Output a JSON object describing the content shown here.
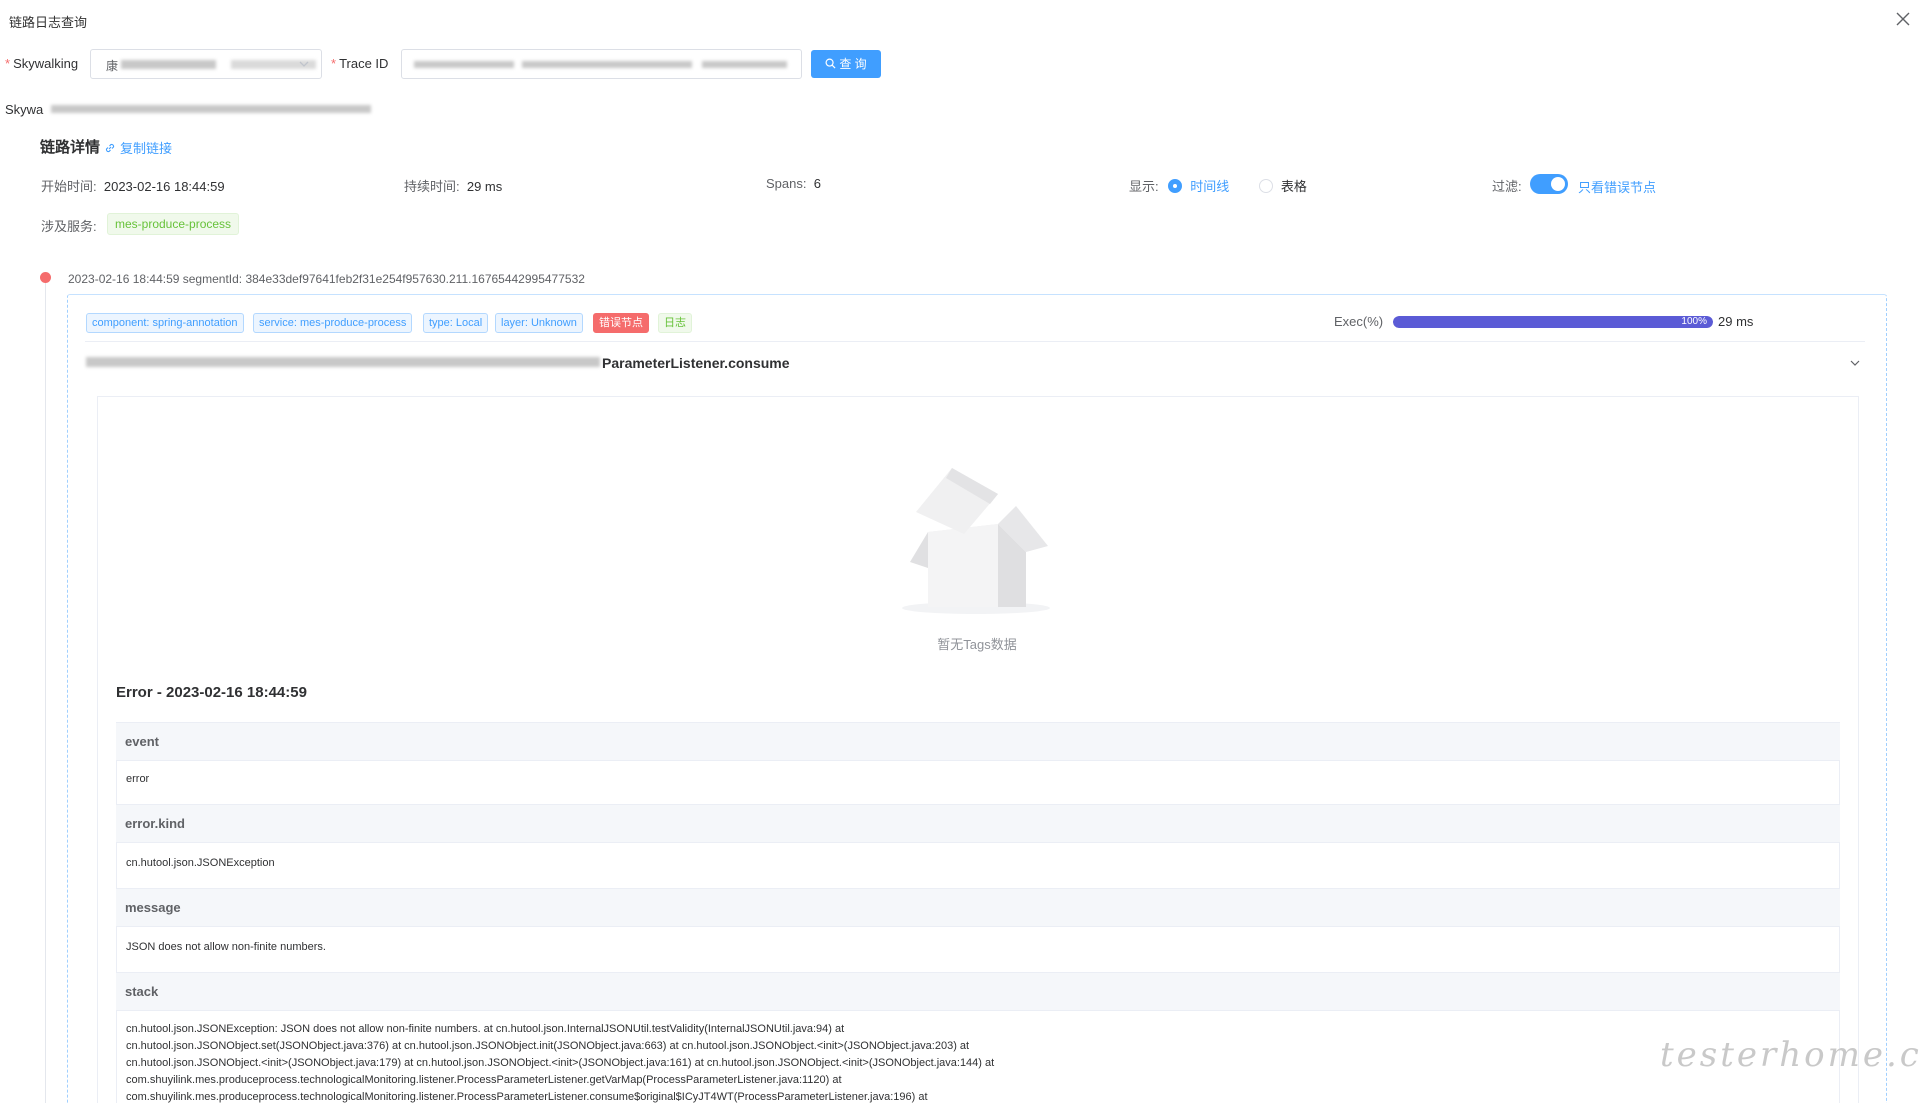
{
  "window": {
    "title": "链路日志查询"
  },
  "search": {
    "skywalking_label": "Skywalking",
    "skywalking_value_prefix": "康",
    "traceid_label": "Trace ID",
    "query_button": "查 询"
  },
  "skywa_label": "Skywa",
  "details": {
    "heading": "链路详情",
    "copy_link": "复制链接",
    "start_time_label": "开始时间:",
    "start_time": "2023-02-16 18:44:59",
    "duration_label": "持续时间:",
    "duration": "29 ms",
    "spans_label": "Spans:",
    "spans": "6",
    "display_label": "显示:",
    "display_timeline": "时间线",
    "display_table": "表格",
    "filter_label": "过滤:",
    "filter_errors_only": "只看错误节点",
    "services_label": "涉及服务:",
    "service_tag": "mes-produce-process"
  },
  "segment": {
    "header": "2023-02-16 18:44:59 segmentId: 384e33def97641feb2f31e254f957630.211.16765442995477532",
    "tags": {
      "component": "component: spring-annotation",
      "service": "service: mes-produce-process",
      "type": "type: Local",
      "layer": "layer: Unknown",
      "error": "错误节点",
      "log": "日志"
    },
    "exec_label": "Exec(%)",
    "exec_percent": 100,
    "exec_percent_text": "100%",
    "exec_ms": "29 ms",
    "method": "ParameterListener.consume",
    "empty_tags": "暂无Tags数据",
    "error_title": "Error - 2023-02-16 18:44:59",
    "log_rows": {
      "event_key": "event",
      "event_value": "error",
      "kind_key": "error.kind",
      "kind_value": "cn.hutool.json.JSONException",
      "message_key": "message",
      "message_value": "JSON does not allow non-finite numbers.",
      "stack_key": "stack",
      "stack_line_1": "cn.hutool.json.JSONException: JSON does not allow non-finite numbers. at cn.hutool.json.InternalJSONUtil.testValidity(InternalJSONUtil.java:94) at",
      "stack_line_2": "cn.hutool.json.JSONObject.set(JSONObject.java:376) at cn.hutool.json.JSONObject.init(JSONObject.java:663) at cn.hutool.json.JSONObject.<init>(JSONObject.java:203) at",
      "stack_line_3": "cn.hutool.json.JSONObject.<init>(JSONObject.java:179) at cn.hutool.json.JSONObject.<init>(JSONObject.java:161) at cn.hutool.json.JSONObject.<init>(JSONObject.java:144) at",
      "stack_line_4": "com.shuyilink.mes.produceprocess.technologicalMonitoring.listener.ProcessParameterListener.getVarMap(ProcessParameterListener.java:1120) at",
      "stack_line_5": "com.shuyilink.mes.produceprocess.technologicalMonitoring.listener.ProcessParameterListener.consume$original$ICyJT4WT(ProcessParameterListener.java:196) at"
    }
  },
  "watermark": "testerhome.com",
  "icons": {
    "close": "close-icon",
    "select_chevron": "chevron-down-icon",
    "search": "search-icon",
    "link": "link-icon",
    "collapse": "chevron-down-icon",
    "empty_box": "empty-box-illustration"
  }
}
